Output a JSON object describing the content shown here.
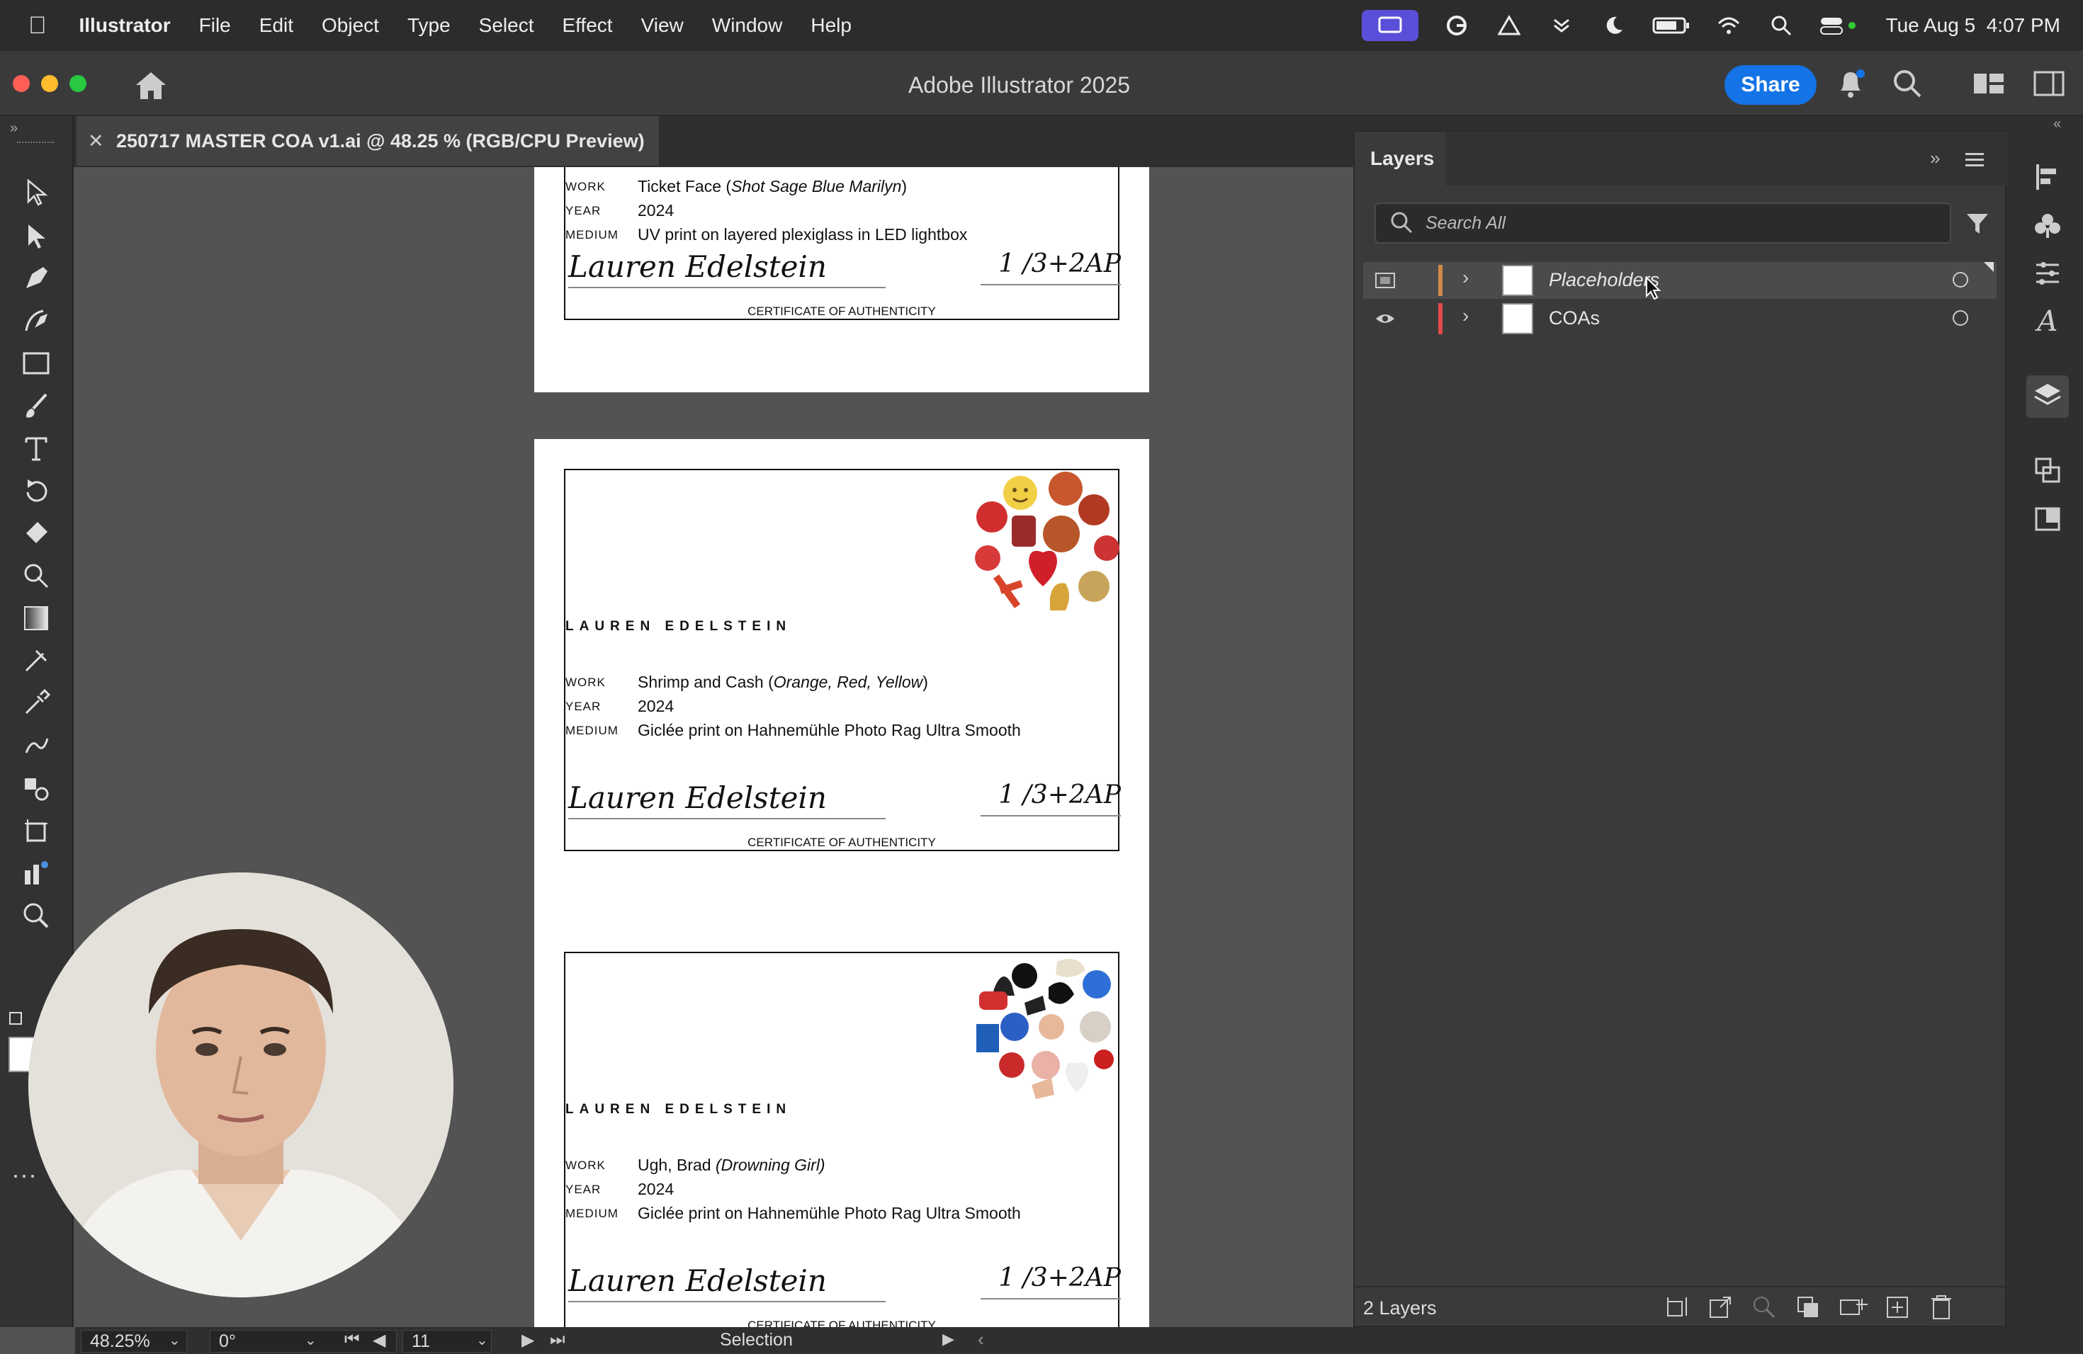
{
  "menubar": {
    "app": "Illustrator",
    "items": [
      "File",
      "Edit",
      "Object",
      "Type",
      "Select",
      "Effect",
      "View",
      "Window",
      "Help"
    ],
    "datetime": "Tue Aug 5  4:07 PM"
  },
  "titlebar": {
    "title": "Adobe Illustrator 2025",
    "share_label": "Share"
  },
  "document": {
    "tab_title": "250717 MASTER COA v1.ai @ 48.25 % (RGB/CPU Preview)"
  },
  "certificates": [
    {
      "author": "",
      "work_label": "WORK",
      "work": "Ticket Face (Shot Sage Blue Marilyn)",
      "year_label": "YEAR",
      "year": "2024",
      "medium_label": "MEDIUM",
      "medium": "UV print on layered plexiglass in LED lightbox",
      "signature": "Lauren Edelstein",
      "edition": "1 /3+2AP",
      "footer": "CERTIFICATE OF AUTHENTICITY"
    },
    {
      "author": "LAUREN EDELSTEIN",
      "work_label": "WORK",
      "work": "Shrimp and Cash (Orange, Red, Yellow)",
      "year_label": "YEAR",
      "year": "2024",
      "medium_label": "MEDIUM",
      "medium": "Giclée print on Hahnemühle Photo Rag Ultra Smooth",
      "signature": "Lauren Edelstein",
      "edition": "1 /3+2AP",
      "footer": "CERTIFICATE OF AUTHENTICITY"
    },
    {
      "author": "LAUREN EDELSTEIN",
      "work_label": "WORK",
      "work": "Ugh, Brad (Drowning Girl)",
      "year_label": "YEAR",
      "year": "2024",
      "medium_label": "MEDIUM",
      "medium": "Giclée print on Hahnemühle Photo Rag Ultra Smooth",
      "signature": "Lauren Edelstein",
      "edition": "1 /3+2AP",
      "footer": "CERTIFICATE OF AUTHENTICITY"
    }
  ],
  "layers_panel": {
    "tab": "Layers",
    "search_placeholder": "Search All",
    "layers": [
      {
        "name": "Placeholders",
        "color": "#d08a4a",
        "selected": true
      },
      {
        "name": "COAs",
        "color": "#e24a4a",
        "selected": false
      }
    ],
    "count": "2 Layers"
  },
  "statusbar": {
    "zoom": "48.25%",
    "rotation": "0°",
    "artboard": "11",
    "tool": "Selection"
  },
  "colors": {
    "accent": "#1473e6",
    "panel": "#3a3a3a",
    "canvas": "#535353"
  }
}
